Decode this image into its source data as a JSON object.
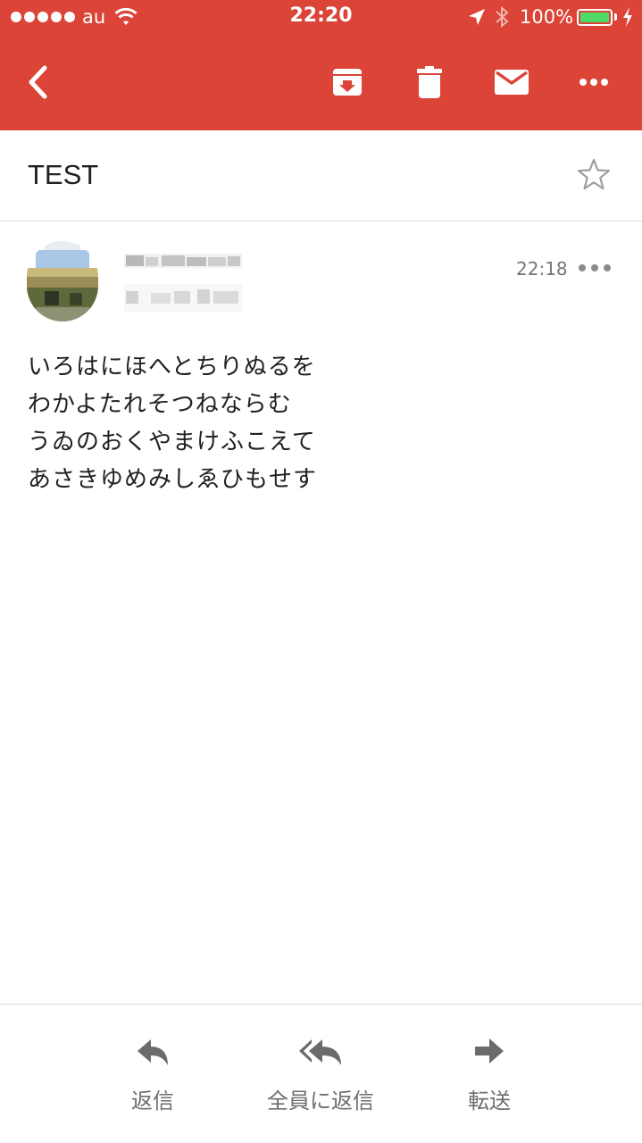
{
  "status_bar": {
    "carrier": "au",
    "time": "22:20",
    "battery_percent": "100%"
  },
  "toolbar": {
    "back_icon": "back-chevron-icon",
    "archive_icon": "archive-icon",
    "delete_icon": "trash-icon",
    "mark_unread_icon": "mail-icon",
    "more_icon": "more-horizontal-icon"
  },
  "email": {
    "subject": "TEST",
    "starred": false,
    "sender_obscured": true,
    "recipient_obscured": true,
    "time": "22:18",
    "body_lines": [
      "いろはにほへとちりぬるを",
      "わかよたれそつねならむ",
      "うゐのおくやまけふこえて",
      "あさきゆめみしゑひもせす"
    ]
  },
  "actions": {
    "reply": "返信",
    "reply_all": "全員に返信",
    "forward": "転送"
  },
  "colors": {
    "header": "#db4437",
    "battery": "#4cd964",
    "muted_text": "#757575"
  }
}
